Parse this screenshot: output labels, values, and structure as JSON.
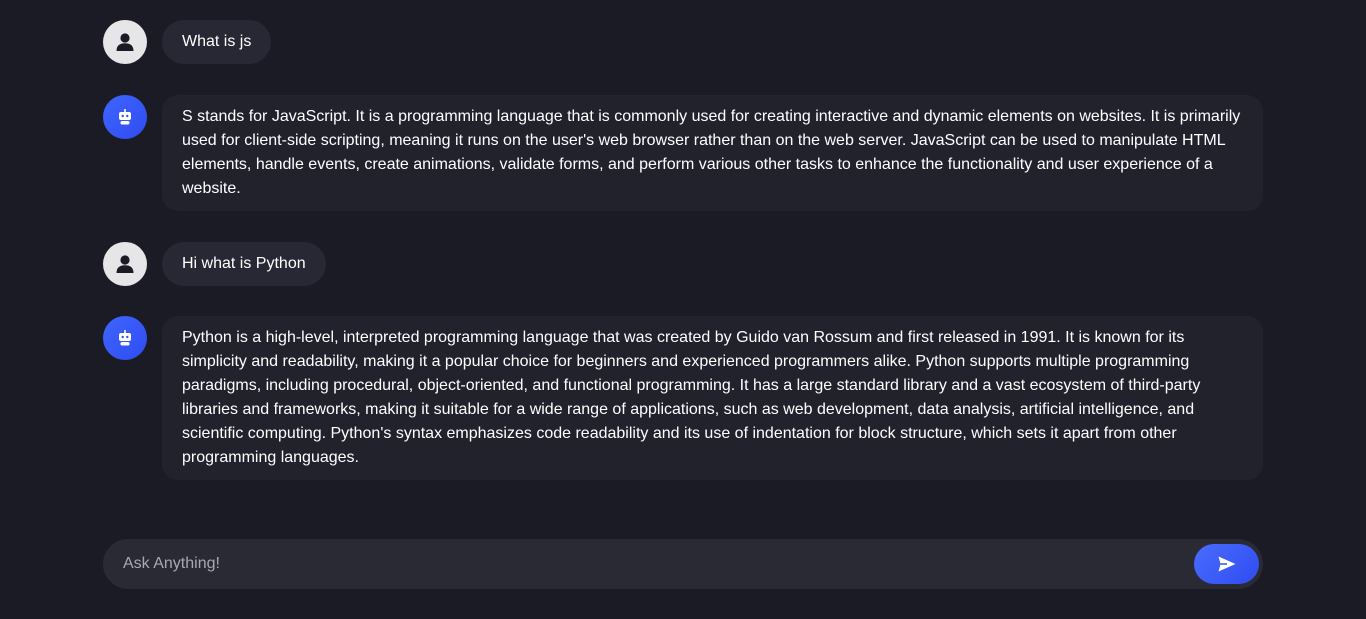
{
  "conversation": [
    {
      "role": "user",
      "avatar_icon": "user-icon",
      "text": "What is js"
    },
    {
      "role": "bot",
      "avatar_icon": "robot-icon",
      "text": "S stands for JavaScript. It is a programming language that is commonly used for creating interactive and dynamic elements on websites. It is primarily used for client-side scripting, meaning it runs on the user's web browser rather than on the web server. JavaScript can be used to manipulate HTML elements, handle events, create animations, validate forms, and perform various other tasks to enhance the functionality and user experience of a website."
    },
    {
      "role": "user",
      "avatar_icon": "user-icon",
      "text": "Hi what is Python"
    },
    {
      "role": "bot",
      "avatar_icon": "robot-icon",
      "text": "Python is a high-level, interpreted programming language that was created by Guido van Rossum and first released in 1991. It is known for its simplicity and readability, making it a popular choice for beginners and experienced programmers alike. Python supports multiple programming paradigms, including procedural, object-oriented, and functional programming. It has a large standard library and a vast ecosystem of third-party libraries and frameworks, making it suitable for a wide range of applications, such as web development, data analysis, artificial intelligence, and scientific computing. Python's syntax emphasizes code readability and its use of indentation for block structure, which sets it apart from other programming languages."
    }
  ],
  "composer": {
    "placeholder": "Ask Anything!",
    "value": "",
    "send_icon": "send-icon"
  },
  "colors": {
    "background": "#1b1b25",
    "user_bubble": "#282834",
    "bot_bubble": "#22222d",
    "accent": "#3f65ff",
    "text": "#ffffff"
  }
}
